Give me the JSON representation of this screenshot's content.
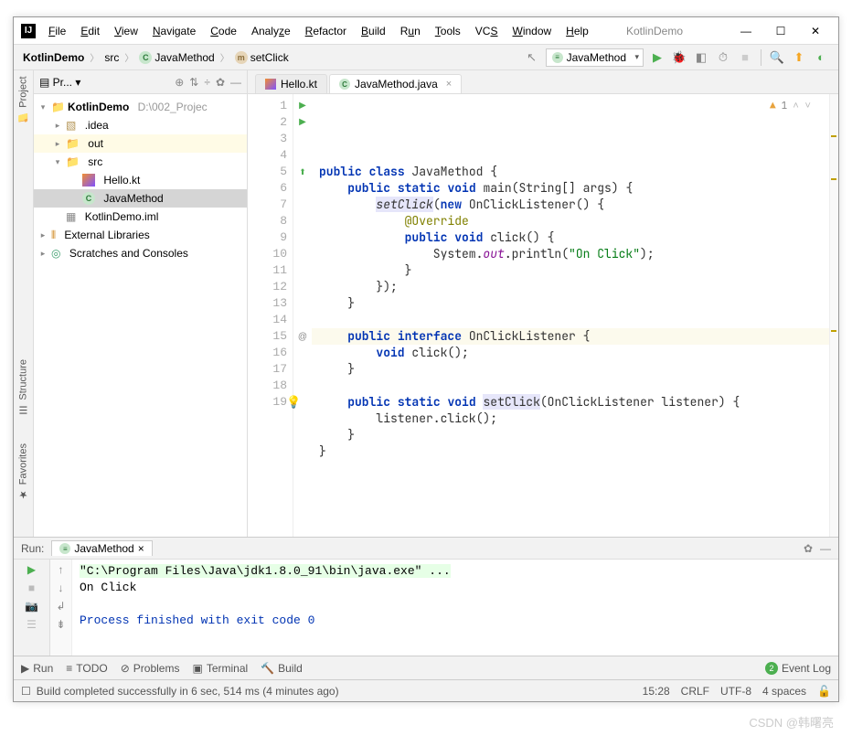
{
  "window": {
    "title": "KotlinDemo",
    "minimize": "—",
    "maximize": "☐",
    "close": "✕"
  },
  "menu": [
    "File",
    "Edit",
    "View",
    "Navigate",
    "Code",
    "Analyze",
    "Refactor",
    "Build",
    "Run",
    "Tools",
    "VCS",
    "Window",
    "Help"
  ],
  "breadcrumb": {
    "root": "KotlinDemo",
    "src": "src",
    "cls": "JavaMethod",
    "method": "setClick"
  },
  "toolbar": {
    "run_config": "JavaMethod",
    "hammer": "⚒",
    "run": "▶",
    "debug": "⌗",
    "coverage": "◧",
    "stop": "■",
    "search": "Q",
    "update": "⬤",
    "more": "◑"
  },
  "project_header": {
    "label": "Pr...",
    "icons": [
      "⊕",
      "⇅",
      "÷",
      "✿",
      "—"
    ]
  },
  "tree": {
    "root": {
      "name": "KotlinDemo",
      "path": "D:\\002_Projec"
    },
    "idea": ".idea",
    "out": "out",
    "src": "src",
    "hello": "Hello.kt",
    "javamethod": "JavaMethod",
    "iml": "KotlinDemo.iml",
    "extlib": "External Libraries",
    "scratches": "Scratches and Consoles"
  },
  "tabs": {
    "hello": "Hello.kt",
    "javamethod": "JavaMethod.java"
  },
  "editor": {
    "warning_count": "1",
    "lines": [
      {
        "n": "1",
        "icon": "▶",
        "html": "<span class='kw'>public</span> <span class='kw'>class</span> JavaMethod {"
      },
      {
        "n": "2",
        "icon": "▶",
        "html": "    <span class='kw'>public</span> <span class='kw'>static</span> <span class='kw'>void</span> main(String[] args) {"
      },
      {
        "n": "3",
        "icon": "",
        "html": "        <span class='mtd-it mtd-hl'>setClick</span>(<span class='kw'>new</span> OnClickListener() {"
      },
      {
        "n": "4",
        "icon": "",
        "html": "            <span class='ann'>@Override</span>"
      },
      {
        "n": "5",
        "icon": "⬆",
        "html": "            <span class='kw'>public</span> <span class='kw'>void</span> click() {"
      },
      {
        "n": "6",
        "icon": "",
        "html": "                System.<span class='fld'>out</span>.println(<span class='str'>\"On Click\"</span>);"
      },
      {
        "n": "7",
        "icon": "",
        "html": "            }"
      },
      {
        "n": "8",
        "icon": "",
        "html": "        });"
      },
      {
        "n": "9",
        "icon": "",
        "html": "    }"
      },
      {
        "n": "10",
        "icon": "",
        "html": ""
      },
      {
        "n": "11",
        "icon": "",
        "html": "    <span class='kw'>public</span> <span class='kw'>interface</span> OnClickListener {"
      },
      {
        "n": "12",
        "icon": "",
        "html": "        <span class='kw'>void</span> click();"
      },
      {
        "n": "13",
        "icon": "",
        "html": "    }"
      },
      {
        "n": "14",
        "icon": "",
        "html": ""
      },
      {
        "n": "15",
        "icon": "@",
        "html": "    <span class='kw'>public</span> <span class='kw'>static</span> <span class='kw'>void</span> <span class='mtd-hl'>setClick</span>(OnClickListener listener) {"
      },
      {
        "n": "16",
        "icon": "",
        "html": "        listener.click();"
      },
      {
        "n": "17",
        "icon": "",
        "html": "    }"
      },
      {
        "n": "18",
        "icon": "",
        "html": "}"
      },
      {
        "n": "19",
        "icon": "",
        "html": ""
      }
    ],
    "bulb_line": 15
  },
  "run": {
    "label": "Run:",
    "tab": "JavaMethod",
    "cmd": "\"C:\\Program Files\\Java\\jdk1.8.0_91\\bin\\java.exe\" ...",
    "output": "On Click",
    "exit": "Process finished with exit code 0"
  },
  "bottom": {
    "run": "Run",
    "todo": "TODO",
    "problems": "Problems",
    "terminal": "Terminal",
    "build": "Build",
    "eventlog": "Event Log"
  },
  "status": {
    "msg": "Build completed successfully in 6 sec, 514 ms (4 minutes ago)",
    "time": "15:28",
    "enc1": "CRLF",
    "enc2": "UTF-8",
    "indent": "4 spaces"
  },
  "sidebars": {
    "project": "Project",
    "structure": "Structure",
    "favorites": "Favorites"
  },
  "watermark": "CSDN @韩曙亮"
}
